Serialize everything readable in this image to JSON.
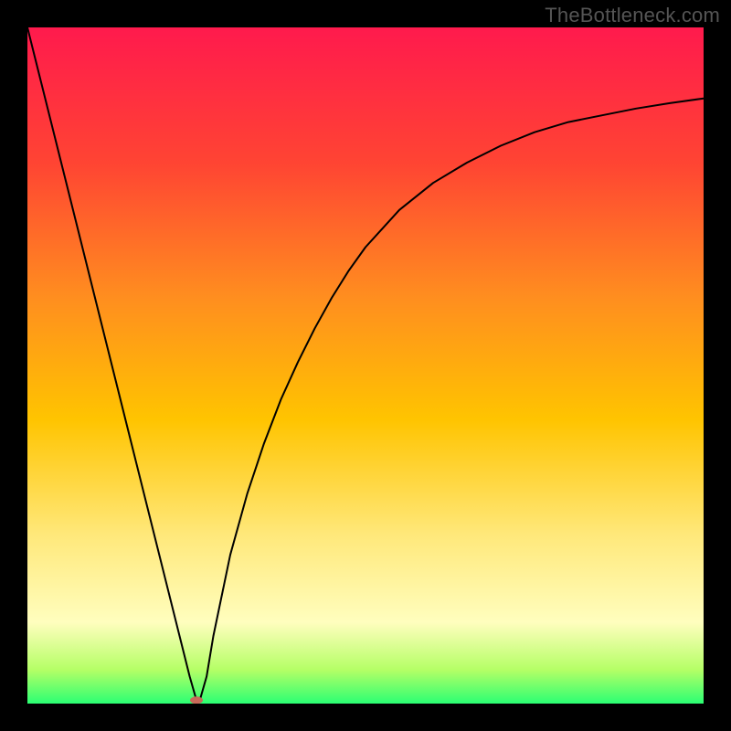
{
  "watermark": "TheBottleneck.com",
  "chart_data": {
    "type": "line",
    "title": "",
    "xlabel": "",
    "ylabel": "",
    "xlim": [
      0,
      100
    ],
    "ylim": [
      0,
      100
    ],
    "grid": false,
    "legend": false,
    "background_gradient_stops": [
      {
        "offset": 0.0,
        "color": "#ff1a4d"
      },
      {
        "offset": 0.2,
        "color": "#ff4433"
      },
      {
        "offset": 0.4,
        "color": "#ff8e1f"
      },
      {
        "offset": 0.58,
        "color": "#ffc400"
      },
      {
        "offset": 0.75,
        "color": "#ffe87a"
      },
      {
        "offset": 0.88,
        "color": "#fffebe"
      },
      {
        "offset": 0.95,
        "color": "#b5ff66"
      },
      {
        "offset": 1.0,
        "color": "#2bff73"
      }
    ],
    "series": [
      {
        "name": "bottleneck-curve",
        "stroke": "#000000",
        "stroke_width": 2,
        "x": [
          0.0,
          2.5,
          5.0,
          7.5,
          10.0,
          12.5,
          15.0,
          17.5,
          20.0,
          22.5,
          24.0,
          25.0,
          25.5,
          26.5,
          27.5,
          30.0,
          32.5,
          35.0,
          37.5,
          40.0,
          42.5,
          45.0,
          47.5,
          50.0,
          55.0,
          60.0,
          65.0,
          70.0,
          75.0,
          80.0,
          85.0,
          90.0,
          95.0,
          100.0
        ],
        "y": [
          100.0,
          90.0,
          80.0,
          70.0,
          60.0,
          50.0,
          40.0,
          30.0,
          20.0,
          10.0,
          4.0,
          0.5,
          0.5,
          4.0,
          10.0,
          22.0,
          31.0,
          38.5,
          45.0,
          50.5,
          55.5,
          60.0,
          64.0,
          67.5,
          73.0,
          77.0,
          80.0,
          82.5,
          84.5,
          86.0,
          87.0,
          88.0,
          88.8,
          89.5
        ]
      }
    ],
    "marker": {
      "name": "optimal-point",
      "x": 25.0,
      "y": 0.5,
      "color": "#c96a5a",
      "rx": 7,
      "ry": 4
    }
  }
}
